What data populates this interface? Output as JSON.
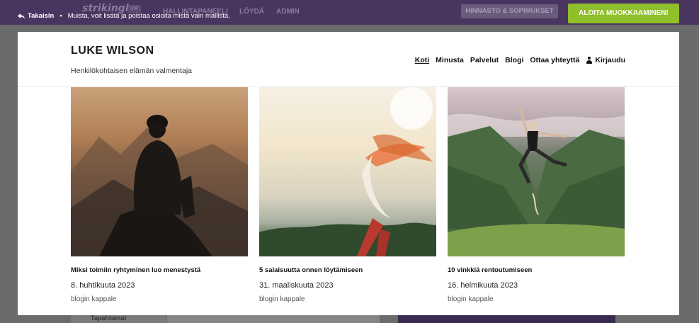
{
  "editor": {
    "logo": "strikingly",
    "vip": "VIP",
    "nav": [
      "HALLINTAPANEELI",
      "LÖYDÄ",
      "ADMIN"
    ],
    "back_label": "Takaisin",
    "note": "Muista, voit lisätä ja poistaa osioita mistä vain mallista.",
    "pricing_label": "HINNASTO & SOPIMUKSET",
    "start_label": "ALOITA MUOKKAAMINEN!"
  },
  "site": {
    "title": "LUKE WILSON",
    "subtitle": "Henkilökohtaisen elämän valmentaja",
    "nav": [
      "Koti",
      "Minusta",
      "Palvelut",
      "Blogi",
      "Ottaa yhteyttä"
    ],
    "login_label": "Kirjaudu"
  },
  "posts": [
    {
      "title": "Miksi toimiin ryhtyminen luo menestystä",
      "date": "8. huhtikuuta 2023",
      "category": "blogin kappale"
    },
    {
      "title": "5 salaisuutta onnen löytämiseen",
      "date": "31. maaliskuuta 2023",
      "category": "blogin kappale"
    },
    {
      "title": "10 vinkkiä rentoutumiseen",
      "date": "16. helmikuuta 2023",
      "category": "blogin kappale"
    }
  ],
  "background": {
    "left_label": "Tapahtumat"
  },
  "colors": {
    "topbar": "#4a3561",
    "accent_green": "#8fbf2a"
  }
}
